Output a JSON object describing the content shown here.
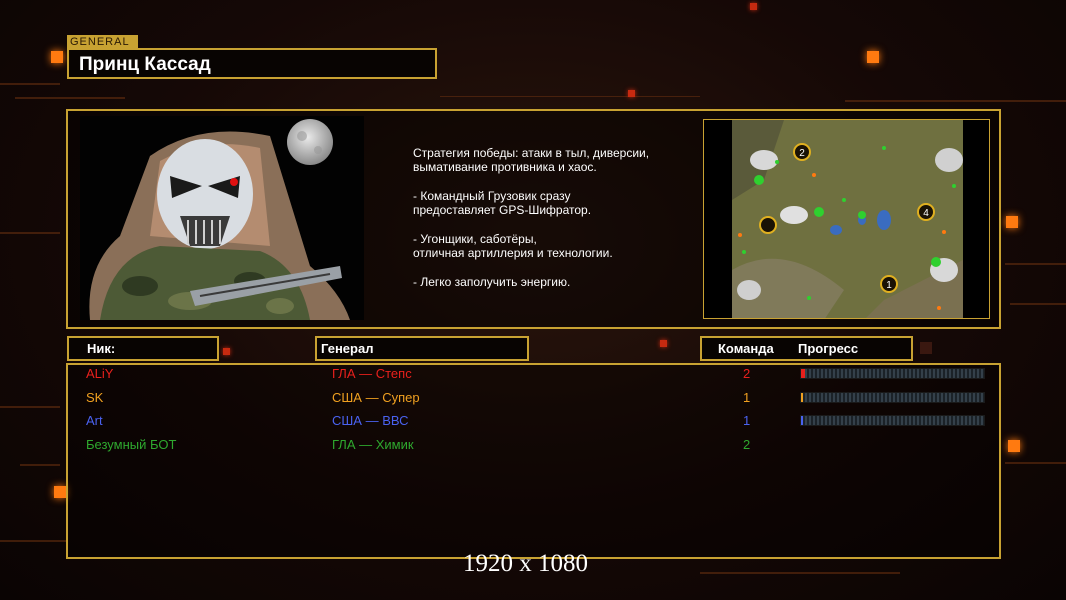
{
  "general_tag": "GENERAL",
  "general_name": "Принц Кассад",
  "description": "Стратегия победы: атаки в тыл, диверсии,\n вымативание противника и хаос.\n\n- Командный Грузовик сразу\nпредоставляет GPS-Шифратор.\n\n- Угонщики, саботёры,\nотличная артиллерия и технологии.\n\n- Легко заполучить энергию.",
  "map_markers": [
    "2",
    "4",
    "1"
  ],
  "headers": {
    "nick": "Ник:",
    "general": "Генерал",
    "team": "Команда",
    "progress": "Прогресс"
  },
  "players": [
    {
      "nick": "ALiY",
      "general": "ГЛА — Степс",
      "team": "2",
      "color": "#e8201c",
      "progress": 0.02
    },
    {
      "nick": "SK",
      "general": "США — Супер",
      "team": "1",
      "color": "#f0a020",
      "progress": 0.01
    },
    {
      "nick": "Art",
      "general": "США — ВВС",
      "team": "1",
      "color": "#4a62f0",
      "progress": 0.01
    },
    {
      "nick": "Безумный БОТ",
      "general": "ГЛА — Химик",
      "team": "2",
      "color": "#2ea82e",
      "progress": null
    }
  ],
  "resolution_label": "1920 x 1080"
}
